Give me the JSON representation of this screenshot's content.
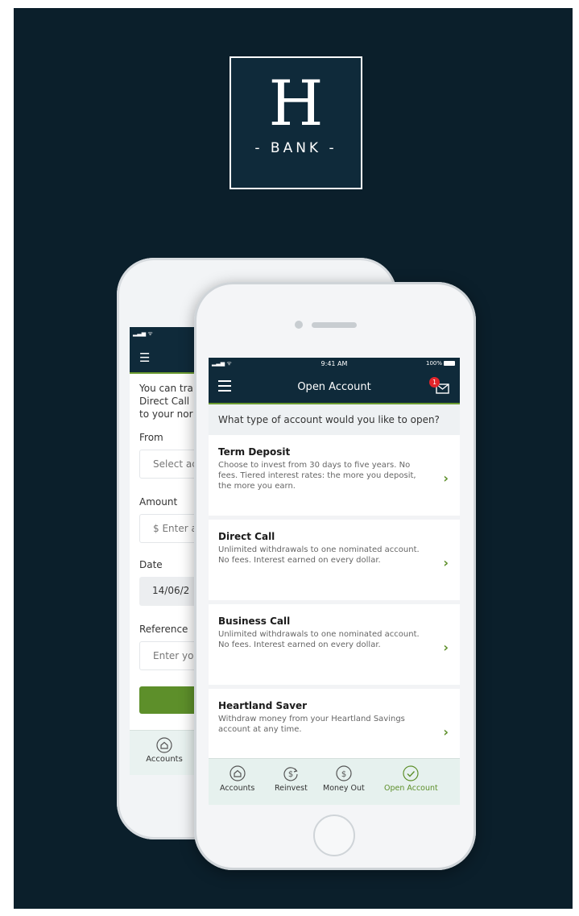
{
  "logo": {
    "letter": "H",
    "word": "- BANK -"
  },
  "back_screen": {
    "intro_lines": [
      "You can tra",
      "Direct Call",
      "to your nor"
    ],
    "from_label": "From",
    "from_placeholder": "Select ac",
    "amount_label": "Amount",
    "amount_placeholder": "$ Enter a",
    "date_label": "Date",
    "date_value": "14/06/2",
    "reference_label": "Reference",
    "reference_placeholder": "Enter yo",
    "tab_label": "Accounts"
  },
  "status": {
    "time": "9:41 AM",
    "battery": "100%"
  },
  "nav": {
    "title": "Open Account",
    "badge_count": "1"
  },
  "question": "What type of account would you like to open?",
  "accounts": [
    {
      "title": "Term Deposit",
      "desc": "Choose to invest from 30 days to five years. No fees. Tiered interest rates: the more you deposit, the more you earn."
    },
    {
      "title": "Direct Call",
      "desc": "Unlimited withdrawals to one nominated account. No fees. Interest earned on every dollar."
    },
    {
      "title": "Business Call",
      "desc": "Unlimited withdrawals to one nominated account. No fees. Interest earned on every dollar."
    },
    {
      "title": "Heartland Saver",
      "desc": "Withdraw money from your Heartland Savings account at any time."
    }
  ],
  "tabs": [
    {
      "label": "Accounts",
      "icon": "home-icon"
    },
    {
      "label": "Reinvest",
      "icon": "reinvest-icon"
    },
    {
      "label": "Money Out",
      "icon": "money-out-icon"
    },
    {
      "label": "Open Account",
      "icon": "check-circle-icon"
    }
  ],
  "colors": {
    "navy": "#0f2a3a",
    "background": "#0b1f2b",
    "accent_green": "#5d8f2a",
    "badge_red": "#e2252b"
  }
}
